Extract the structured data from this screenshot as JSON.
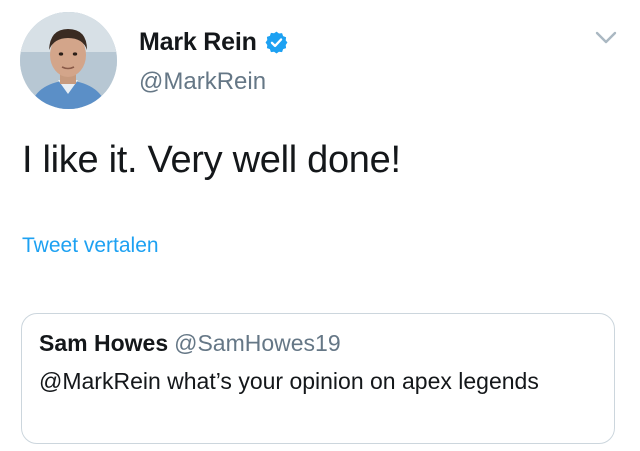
{
  "author": {
    "display_name": "Mark Rein",
    "handle": "@MarkRein",
    "verified": true
  },
  "tweet": {
    "text": "I like it. Very well done!"
  },
  "translate_link": "Tweet vertalen",
  "quoted_tweet": {
    "display_name": "Sam Howes",
    "handle": "@SamHowes19",
    "text": "@MarkRein what’s your opinion on apex legends"
  },
  "colors": {
    "link": "#1da1f2",
    "secondary_text": "#657786",
    "primary_text": "#14171a",
    "card_border": "#ccd6dd"
  },
  "icons": {
    "verified": "verified-badge-icon",
    "menu": "chevron-down-icon"
  }
}
